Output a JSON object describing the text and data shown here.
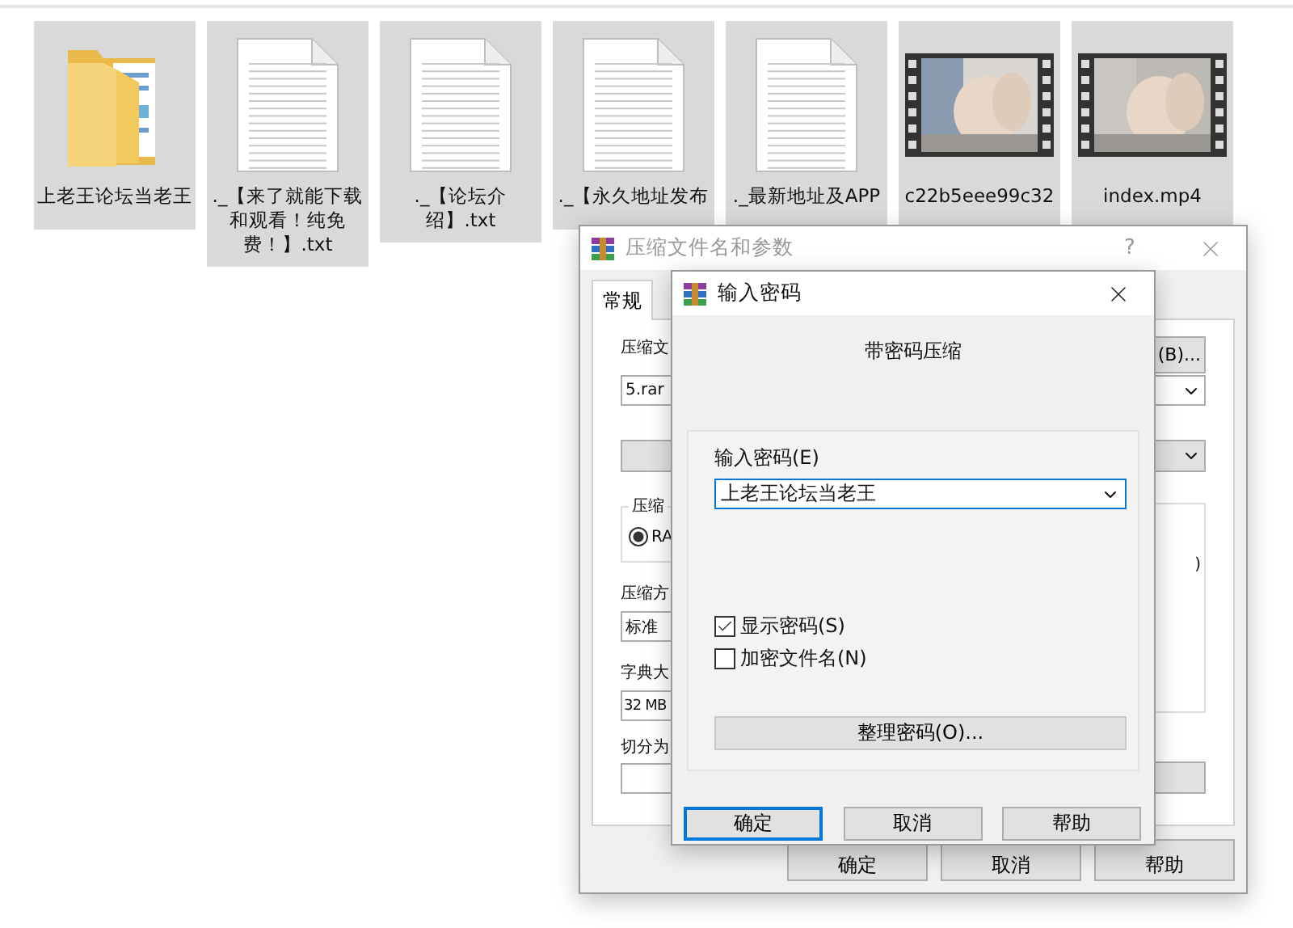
{
  "files": [
    {
      "kind": "folder",
      "name": "上老王论坛当老王",
      "selected": true
    },
    {
      "kind": "text",
      "name": "._【来了就能下载和观看！纯免费！】.txt",
      "selected": true
    },
    {
      "kind": "text",
      "name": "._【论坛介绍】.txt",
      "selected": true
    },
    {
      "kind": "text",
      "name": "._【永久地址发布",
      "selected": true
    },
    {
      "kind": "text",
      "name": "._最新地址及APP",
      "selected": true
    },
    {
      "kind": "video",
      "name": "c22b5eee99c32",
      "selected": true
    },
    {
      "kind": "video",
      "name": "index.mp4",
      "selected": true
    }
  ],
  "back_dialog": {
    "title": "压缩文件名和参数",
    "help": "?",
    "tabs": [
      {
        "label": "常规",
        "selected": true
      }
    ],
    "archive_label": "压缩文",
    "browse_button": "(B)...",
    "archive_name": "5.rar",
    "format_group": "压缩",
    "format_radio": {
      "label": "RA",
      "selected": true
    },
    "method_label": "压缩方",
    "method_value": "标准",
    "dict_label": "字典大",
    "dict_value": "32 MB",
    "split_label": "切分为",
    "options_fragment": ")",
    "buttons": [
      "确定",
      "取消",
      "帮助"
    ]
  },
  "front_dialog": {
    "title": "输入密码",
    "heading": "带密码压缩",
    "password_label": "输入密码(E)",
    "password_value": "上老王论坛当老王",
    "options": [
      {
        "label": "显示密码(S)",
        "checked": true
      },
      {
        "label": "加密文件名(N)",
        "checked": false
      }
    ],
    "organize_button": "整理密码(O)...",
    "buttons": [
      {
        "label": "确定",
        "default": true
      },
      {
        "label": "取消",
        "default": false
      },
      {
        "label": "帮助",
        "default": false
      }
    ]
  }
}
